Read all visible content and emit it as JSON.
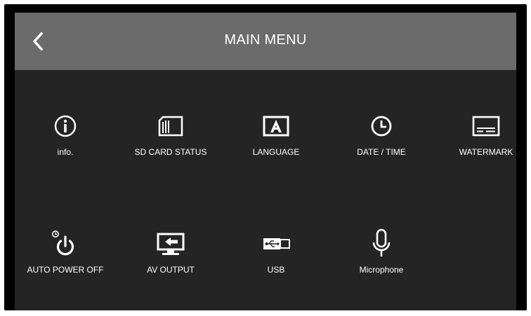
{
  "header": {
    "title": "MAIN MENU",
    "back_icon": "chevron-left-icon"
  },
  "menu": {
    "items": [
      {
        "label": "info.",
        "icon": "info-icon"
      },
      {
        "label": "SD CARD STATUS",
        "icon": "sd-card-icon"
      },
      {
        "label": "LANGUAGE",
        "icon": "language-icon"
      },
      {
        "label": "DATE / TIME",
        "icon": "clock-icon"
      },
      {
        "label": "WATERMARK",
        "icon": "watermark-icon"
      },
      {
        "label": "AUTO POWER OFF",
        "icon": "auto-power-off-icon"
      },
      {
        "label": "AV OUTPUT",
        "icon": "av-output-icon"
      },
      {
        "label": "USB",
        "icon": "usb-icon"
      },
      {
        "label": "Microphone",
        "icon": "microphone-icon"
      }
    ]
  },
  "colors": {
    "header_bg": "#6b6b6b",
    "panel_bg": "#242424",
    "frame_bg": "#000000",
    "text": "#ffffff"
  }
}
